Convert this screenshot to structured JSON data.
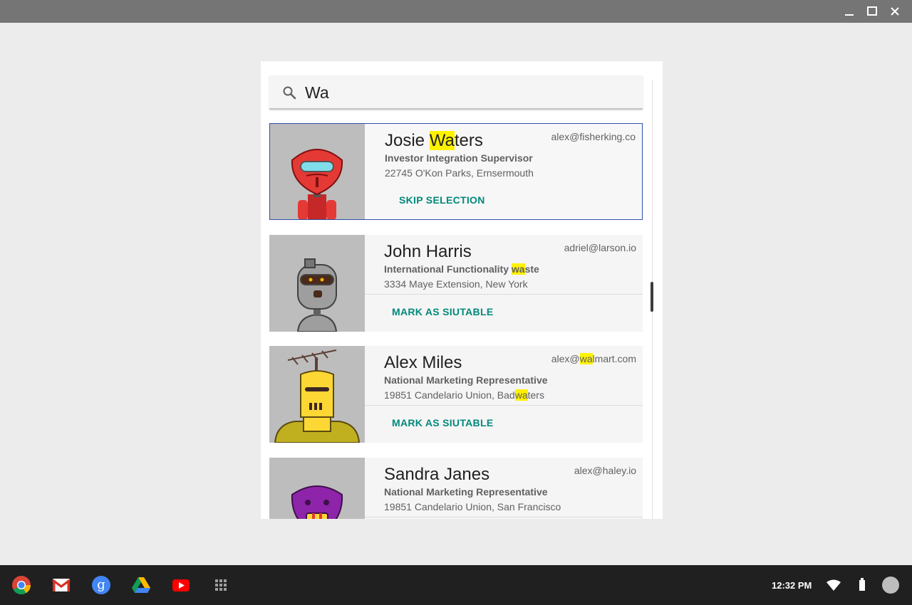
{
  "window": {
    "minimize_icon": "minimize-icon",
    "maximize_icon": "maximize-icon",
    "close_icon": "close-icon"
  },
  "search": {
    "value": "Wa",
    "icon": "search-icon"
  },
  "cards": [
    {
      "name_pre": "Josie ",
      "name_hl": "Wa",
      "name_post": "ters",
      "email": "alex@fisherking.co",
      "role": "Investor Integration Supervisor",
      "address": "22745 O'Kon Parks, Ernsermouth",
      "action": "SKIP SELECTION",
      "selected": true,
      "robot_color": "#e53935"
    },
    {
      "name": "John Harris",
      "email": "adriel@larson.io",
      "role_pre": "International Functionality ",
      "role_hl": "wa",
      "role_post": "ste",
      "address": "3334 Maye Extension, New York",
      "action": "MARK AS SIUTABLE",
      "robot_color": "#9e9e9e"
    },
    {
      "name": "Alex Miles",
      "email_pre": "alex@",
      "email_hl": "wa",
      "email_post": "lmart.com",
      "role": "National Marketing Representative",
      "address_pre": "19851 Candelario Union,  Bad",
      "address_hl": "wa",
      "address_post": "ters",
      "action": "MARK AS SIUTABLE",
      "robot_color": "#fdd835"
    },
    {
      "name": "Sandra Janes",
      "email": "alex@haley.io",
      "role": "National Marketing Representative",
      "address": "19851 Candelario Union,  San Francisco",
      "robot_color": "#8e24aa"
    }
  ],
  "taskbar": {
    "apps": [
      "chrome-icon",
      "gmail-icon",
      "google-search-icon",
      "drive-icon",
      "youtube-icon",
      "app-launcher-icon"
    ],
    "time": "12:32 PM",
    "tray": [
      "wifi-icon",
      "battery-icon",
      "account-avatar"
    ]
  },
  "colors": {
    "accent": "#00897b",
    "highlight": "#fff200",
    "selection_border": "#2c4fa8"
  }
}
